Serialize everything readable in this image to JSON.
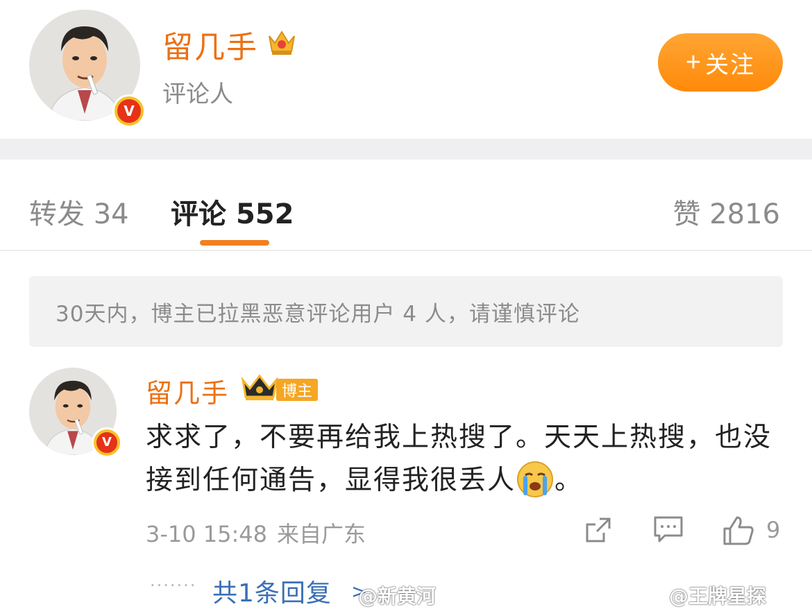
{
  "profile": {
    "name": "留几手",
    "role": "评论人",
    "follow_label": "关注",
    "follow_plus": "+"
  },
  "tabs": {
    "reposts_label": "转发",
    "reposts_count": "34",
    "comments_label": "评论",
    "comments_count": "552",
    "likes_label": "赞",
    "likes_count": "2816"
  },
  "notice": "30天内，博主已拉黑恶意评论用户 4 人，请谨慎评论",
  "comment": {
    "author": "留几手",
    "badge": "博主",
    "text_part1": "求求了，不要再给我上热搜了。天天上热搜，也没接到任何通告，显得我很丢人",
    "text_part2": "。",
    "time": "3-10 15:48",
    "location": "来自广东",
    "like_count": "9",
    "reply_dots": "·······",
    "reply_link": "共1条回复",
    "reply_chevron": ">"
  },
  "watermarks": {
    "left": "@新黄河",
    "right": "@王牌星探"
  },
  "colors": {
    "accent_orange": "#ec7014",
    "follow_button": "#ff8a0a",
    "link_blue": "#3b6fb6",
    "muted_gray": "#8b8b8b"
  },
  "icons": [
    "crown-icon",
    "verified-v-icon",
    "share-icon",
    "comment-icon",
    "like-thumb-icon",
    "crying-emoji-icon"
  ]
}
